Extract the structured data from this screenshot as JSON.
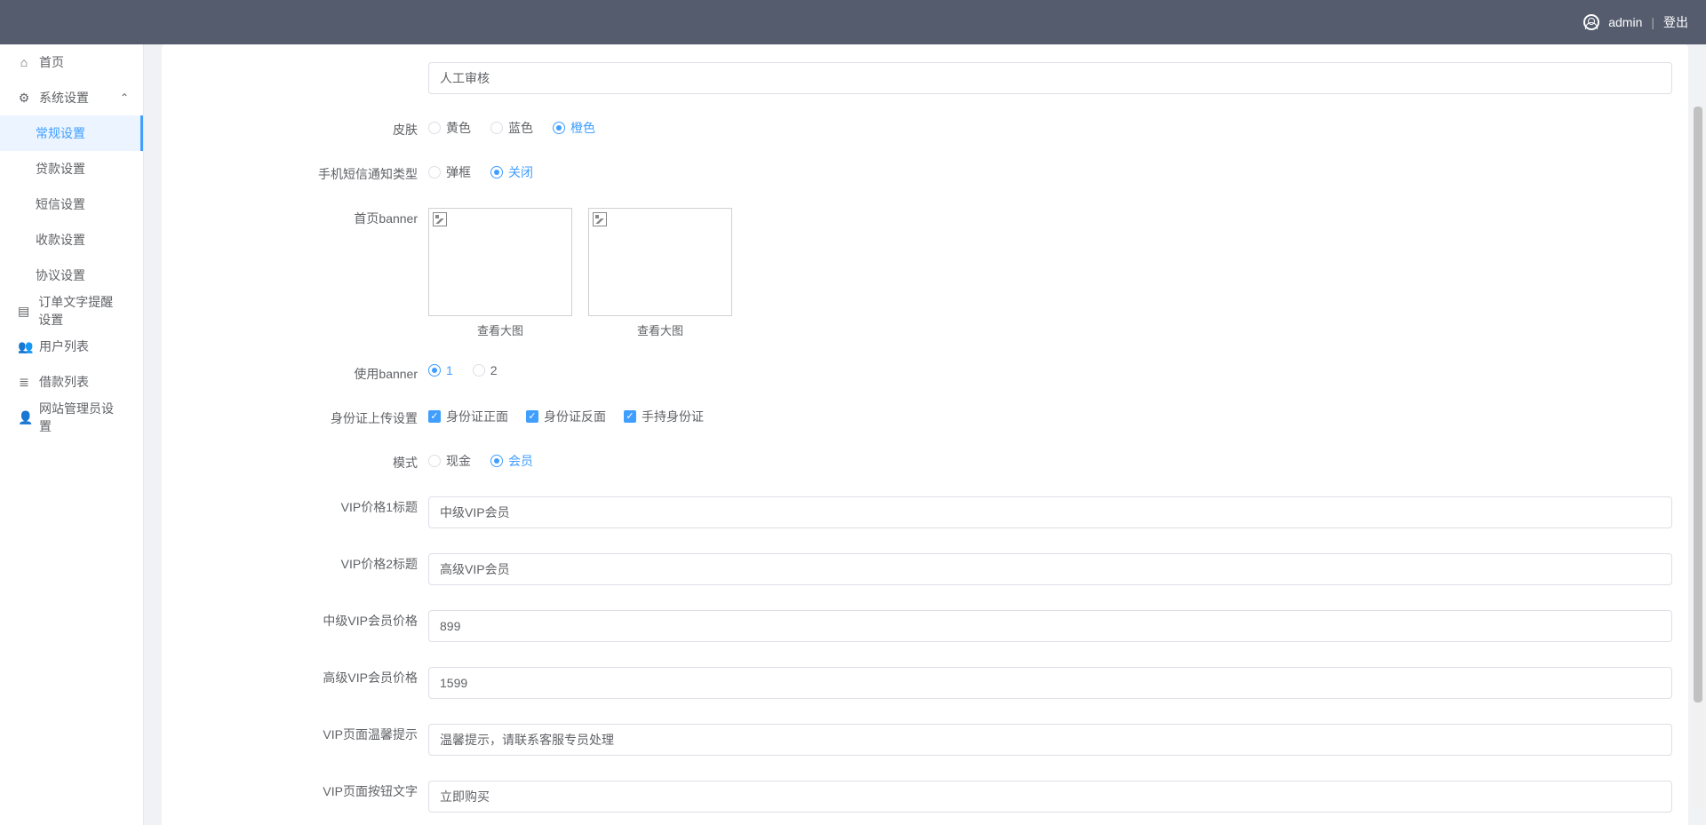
{
  "header": {
    "username": "admin",
    "divider": "|",
    "logout": "登出"
  },
  "sidebar": {
    "home": "首页",
    "system": "系统设置",
    "system_children": {
      "general": "常规设置",
      "loan": "贷款设置",
      "sms": "短信设置",
      "collect": "收款设置",
      "agreement": "协议设置"
    },
    "order_tip": "订单文字提醒设置",
    "user_list": "用户列表",
    "borrow_list": "借款列表",
    "admin": "网站管理员设置"
  },
  "form": {
    "top_input_value": "人工审核",
    "skin": {
      "label": "皮肤",
      "options": {
        "yellow": "黄色",
        "blue": "蓝色",
        "orange": "橙色"
      },
      "selected": "orange"
    },
    "sms_type": {
      "label": "手机短信通知类型",
      "options": {
        "popup": "弹框",
        "off": "关闭"
      },
      "selected": "off"
    },
    "banner": {
      "label": "首页banner",
      "view_large": "查看大图"
    },
    "use_banner": {
      "label": "使用banner",
      "options": {
        "one": "1",
        "two": "2"
      },
      "selected": "one"
    },
    "idcard": {
      "label": "身份证上传设置",
      "front": "身份证正面",
      "back": "身份证反面",
      "hand": "手持身份证"
    },
    "mode": {
      "label": "模式",
      "options": {
        "cash": "现金",
        "member": "会员"
      },
      "selected": "member"
    },
    "vip_title1": {
      "label": "VIP价格1标题",
      "value": "中级VIP会员"
    },
    "vip_title2": {
      "label": "VIP价格2标题",
      "value": "高级VIP会员"
    },
    "mid_vip_price": {
      "label": "中级VIP会员价格",
      "value": "899"
    },
    "high_vip_price": {
      "label": "高级VIP会员价格",
      "value": "1599"
    },
    "vip_tip": {
      "label": "VIP页面温馨提示",
      "value": "温馨提示，请联系客服专员处理"
    },
    "vip_btn_text": {
      "label": "VIP页面按钮文字",
      "value": "立即购买"
    }
  }
}
